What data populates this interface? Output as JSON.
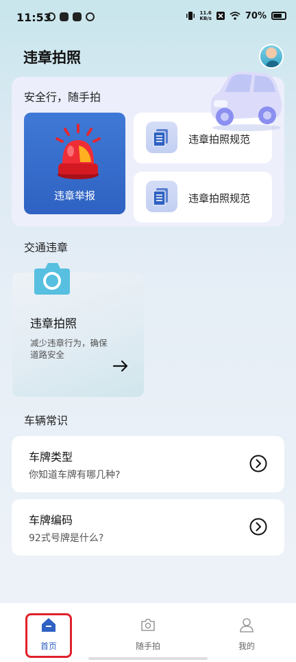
{
  "status_bar": {
    "time": "11:53",
    "speed_value": "11.6",
    "speed_unit": "KB/s",
    "battery": "70%"
  },
  "header": {
    "title": "违章拍照"
  },
  "top_card": {
    "title": "安全行，随手拍",
    "report_label": "违章举报",
    "rule_buttons": [
      {
        "label": "违章拍照规范",
        "icon": "document-icon"
      },
      {
        "label": "违章拍照规范",
        "icon": "document-icon"
      }
    ]
  },
  "traffic_section": {
    "title": "交通违章",
    "card": {
      "title": "违章拍照",
      "description": "减少违章行为，确保道路安全",
      "icon": "camera-icon"
    }
  },
  "vehicle_section": {
    "title": "车辆常识",
    "items": [
      {
        "title": "车牌类型",
        "subtitle": "你知道车牌有哪几种?"
      },
      {
        "title": "车牌编码",
        "subtitle": "92式号牌是什么?"
      }
    ]
  },
  "bottom_nav": {
    "items": [
      {
        "label": "首页",
        "icon": "home-icon",
        "active": true
      },
      {
        "label": "随手拍",
        "icon": "camera-icon",
        "active": false
      },
      {
        "label": "我的",
        "icon": "person-icon",
        "active": false
      }
    ]
  },
  "colors": {
    "accent": "#2f62c2",
    "highlight": "#e0202a"
  }
}
